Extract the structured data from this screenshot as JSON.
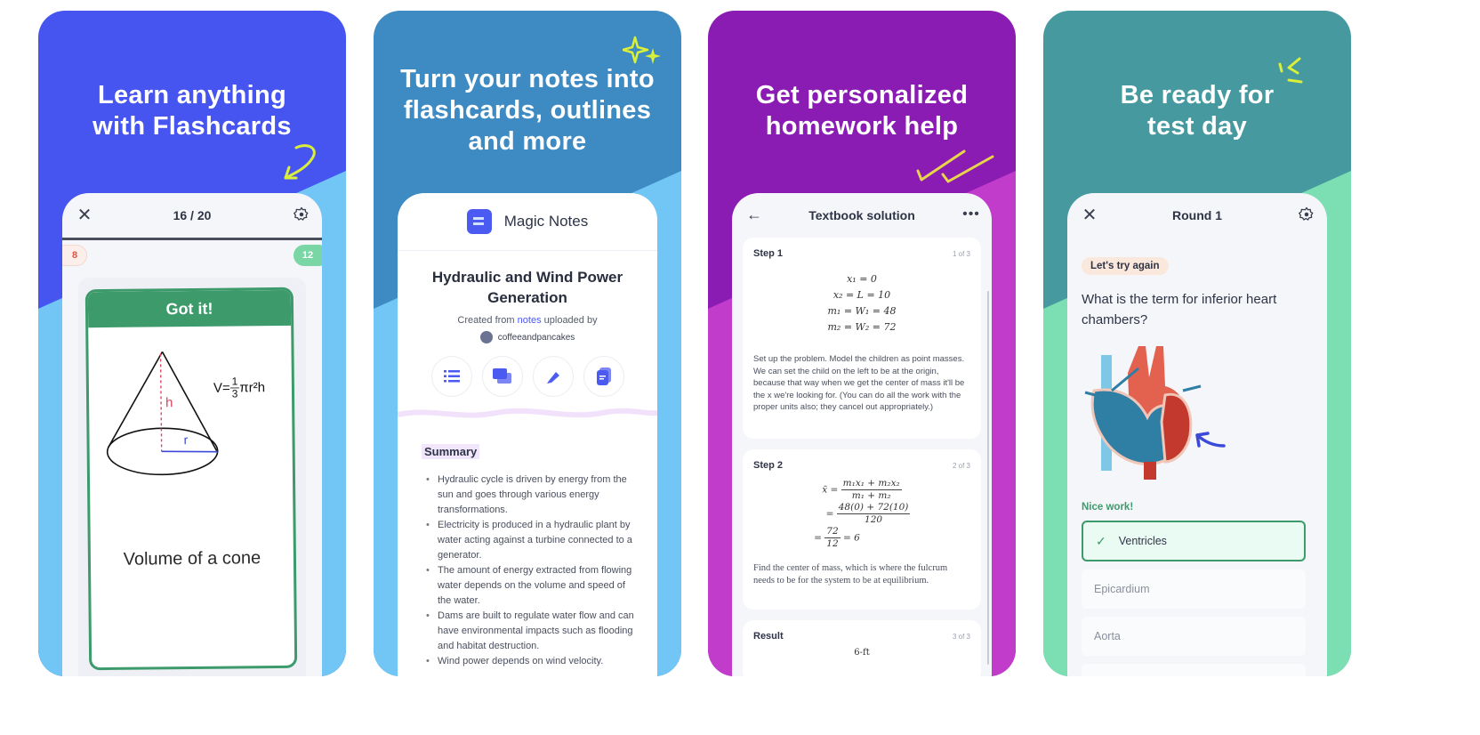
{
  "panels": [
    {
      "headline": [
        "Learn anything",
        "with Flashcards"
      ],
      "background": "#4655f0",
      "screen": {
        "title": "16 / 20",
        "close_icon": "close-icon",
        "settings_icon": "gear-icon",
        "still_learning_count": "8",
        "know_count": "12",
        "card_status": "Got it!",
        "formula": {
          "prefix": "V=",
          "num": "1",
          "den": "3",
          "suffix": "πr²h"
        },
        "diagram_labels": {
          "height": "h",
          "radius": "r"
        },
        "card_term": "Volume of a cone"
      }
    },
    {
      "headline": [
        "Turn your notes into",
        "flashcards, outlines",
        "and more"
      ],
      "background": "#3d8bc2",
      "screen": {
        "app_title": "Magic Notes",
        "doc_title": "Hydraulic and Wind Power Generation",
        "created_prefix": "Created from",
        "created_link": "notes",
        "created_suffix": "uploaded by",
        "uploader": "coffeeandpancakes",
        "tools": [
          "outline-icon",
          "flashcards-icon",
          "highlighter-icon",
          "document-icon"
        ],
        "summary_label": "Summary",
        "summary_items": [
          "Hydraulic cycle is driven by energy from the sun and goes through various energy transformations.",
          "Electricity is produced in a hydraulic plant by water acting against a turbine connected to a generator.",
          "The amount of energy extracted from flowing water depends on the volume and speed of the water.",
          "Dams are built to regulate water flow and can have environmental impacts such as flooding and habitat destruction.",
          "Wind power depends on wind velocity."
        ]
      }
    },
    {
      "headline": [
        "Get personalized",
        "homework help"
      ],
      "background": "#8a1cb4",
      "screen": {
        "title": "Textbook solution",
        "back_icon": "arrow-left-icon",
        "more_icon": "more-icon",
        "steps": [
          {
            "label": "Step 1",
            "counter": "1 of 3",
            "math": [
              "x₁ = 0",
              "x₂ = L = 10",
              "m₁ = W₁ = 48",
              "m₂ = W₂ = 72"
            ],
            "text": "Set up the problem. Model the children as point masses. We can set the child on the left to be at the origin, because that way when we get the center of mass it'll be the x we're looking for. (You can do all the work with the proper units also; they cancel out appropriately.)"
          },
          {
            "label": "Step 2",
            "counter": "2 of 3",
            "math": {
              "lhs": "x̄ =",
              "f1_num": "m₁x₁ + m₂x₂",
              "f1_den": "m₁ + m₂",
              "f2_num": "48(0) + 72(10)",
              "f2_den": "120",
              "f3_num": "72",
              "f3_den": "12",
              "f3_result": "= 6"
            },
            "text": "Find the center of mass, which is where the fulcrum needs to be for the system to be at equilibrium."
          },
          {
            "label": "Result",
            "counter": "3 of 3",
            "value": "6-ft"
          }
        ]
      }
    },
    {
      "headline": [
        "Be ready for",
        "test day"
      ],
      "background": "#45999f",
      "screen": {
        "title": "Round 1",
        "feedback_badge": "Let's try again",
        "question": "What is the term for inferior heart chambers?",
        "result_label": "Nice work!",
        "options": [
          {
            "label": "Ventricles",
            "state": "correct"
          },
          {
            "label": "Epicardium",
            "state": "default"
          },
          {
            "label": "Aorta",
            "state": "default"
          }
        ]
      }
    }
  ],
  "colors": {
    "accent_yellow": "#d9ef3a",
    "success_green": "#3d9a6b",
    "brand_blue": "#4b5af0",
    "light_blue": "#71c6f5",
    "magenta": "#c23ccc",
    "mint": "#7bdfb3"
  }
}
